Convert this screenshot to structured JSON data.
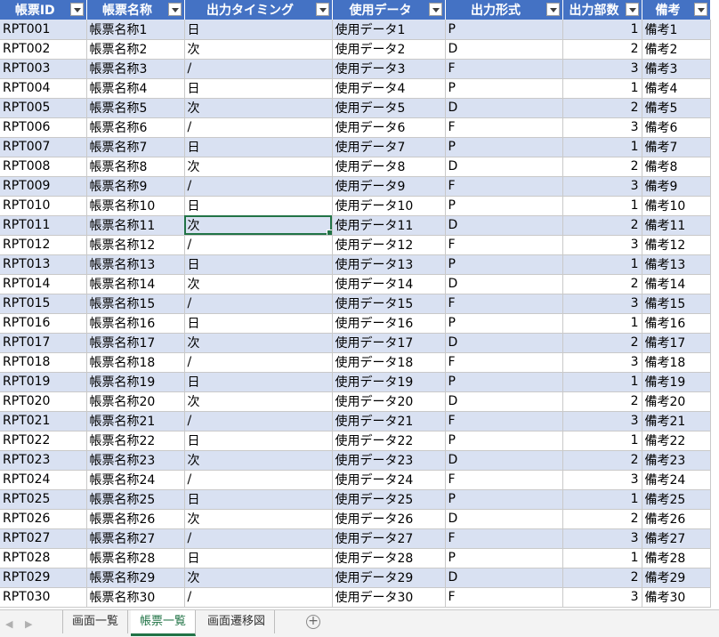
{
  "table": {
    "headers": [
      "帳票ID",
      "帳票名称",
      "出力タイミング",
      "使用データ",
      "出力形式",
      "出力部数",
      "備考"
    ],
    "rows": [
      [
        "RPT001",
        "帳票名称1",
        "日",
        "使用データ1",
        "P",
        "1",
        "備考1"
      ],
      [
        "RPT002",
        "帳票名称2",
        "次",
        "使用データ2",
        "D",
        "2",
        "備考2"
      ],
      [
        "RPT003",
        "帳票名称3",
        "/",
        "使用データ3",
        "F",
        "3",
        "備考3"
      ],
      [
        "RPT004",
        "帳票名称4",
        "日",
        "使用データ4",
        "P",
        "1",
        "備考4"
      ],
      [
        "RPT005",
        "帳票名称5",
        "次",
        "使用データ5",
        "D",
        "2",
        "備考5"
      ],
      [
        "RPT006",
        "帳票名称6",
        "/",
        "使用データ6",
        "F",
        "3",
        "備考6"
      ],
      [
        "RPT007",
        "帳票名称7",
        "日",
        "使用データ7",
        "P",
        "1",
        "備考7"
      ],
      [
        "RPT008",
        "帳票名称8",
        "次",
        "使用データ8",
        "D",
        "2",
        "備考8"
      ],
      [
        "RPT009",
        "帳票名称9",
        "/",
        "使用データ9",
        "F",
        "3",
        "備考9"
      ],
      [
        "RPT010",
        "帳票名称10",
        "日",
        "使用データ10",
        "P",
        "1",
        "備考10"
      ],
      [
        "RPT011",
        "帳票名称11",
        "次",
        "使用データ11",
        "D",
        "2",
        "備考11"
      ],
      [
        "RPT012",
        "帳票名称12",
        "/",
        "使用データ12",
        "F",
        "3",
        "備考12"
      ],
      [
        "RPT013",
        "帳票名称13",
        "日",
        "使用データ13",
        "P",
        "1",
        "備考13"
      ],
      [
        "RPT014",
        "帳票名称14",
        "次",
        "使用データ14",
        "D",
        "2",
        "備考14"
      ],
      [
        "RPT015",
        "帳票名称15",
        "/",
        "使用データ15",
        "F",
        "3",
        "備考15"
      ],
      [
        "RPT016",
        "帳票名称16",
        "日",
        "使用データ16",
        "P",
        "1",
        "備考16"
      ],
      [
        "RPT017",
        "帳票名称17",
        "次",
        "使用データ17",
        "D",
        "2",
        "備考17"
      ],
      [
        "RPT018",
        "帳票名称18",
        "/",
        "使用データ18",
        "F",
        "3",
        "備考18"
      ],
      [
        "RPT019",
        "帳票名称19",
        "日",
        "使用データ19",
        "P",
        "1",
        "備考19"
      ],
      [
        "RPT020",
        "帳票名称20",
        "次",
        "使用データ20",
        "D",
        "2",
        "備考20"
      ],
      [
        "RPT021",
        "帳票名称21",
        "/",
        "使用データ21",
        "F",
        "3",
        "備考21"
      ],
      [
        "RPT022",
        "帳票名称22",
        "日",
        "使用データ22",
        "P",
        "1",
        "備考22"
      ],
      [
        "RPT023",
        "帳票名称23",
        "次",
        "使用データ23",
        "D",
        "2",
        "備考23"
      ],
      [
        "RPT024",
        "帳票名称24",
        "/",
        "使用データ24",
        "F",
        "3",
        "備考24"
      ],
      [
        "RPT025",
        "帳票名称25",
        "日",
        "使用データ25",
        "P",
        "1",
        "備考25"
      ],
      [
        "RPT026",
        "帳票名称26",
        "次",
        "使用データ26",
        "D",
        "2",
        "備考26"
      ],
      [
        "RPT027",
        "帳票名称27",
        "/",
        "使用データ27",
        "F",
        "3",
        "備考27"
      ],
      [
        "RPT028",
        "帳票名称28",
        "日",
        "使用データ28",
        "P",
        "1",
        "備考28"
      ],
      [
        "RPT029",
        "帳票名称29",
        "次",
        "使用データ29",
        "D",
        "2",
        "備考29"
      ],
      [
        "RPT030",
        "帳票名称30",
        "/",
        "使用データ30",
        "F",
        "3",
        "備考30"
      ]
    ],
    "numeric_columns": [
      5
    ],
    "selected_cell": {
      "row": 10,
      "col": 2
    }
  },
  "sheet_tabs": [
    {
      "label": "画面一覧",
      "active": false
    },
    {
      "label": "帳票一覧",
      "active": true
    },
    {
      "label": "画面遷移図",
      "active": false
    }
  ],
  "icons": {
    "add_sheet": "plus-circle-icon",
    "filter": "filter-dropdown-icon",
    "nav_prev": "triangle-left-icon",
    "nav_next": "triangle-right-icon"
  },
  "colors": {
    "header_bg": "#4472C4",
    "band_bg": "#D9E1F2",
    "selection": "#217346"
  }
}
